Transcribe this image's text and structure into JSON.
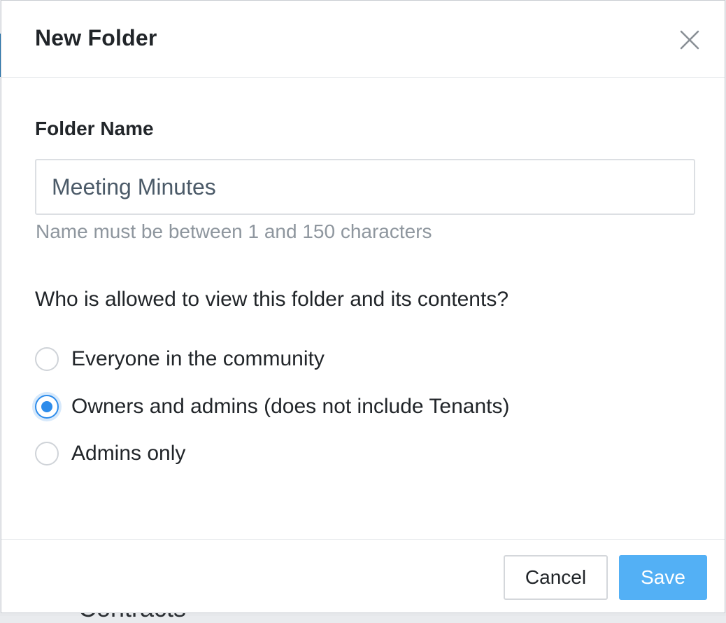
{
  "background": {
    "partial_text": "Contracts"
  },
  "dialog": {
    "title": "New Folder",
    "close_icon": "close-icon"
  },
  "folder_name": {
    "label": "Folder Name",
    "value": "Meeting Minutes",
    "hint": "Name must be between 1 and 150 characters"
  },
  "visibility": {
    "question": "Who is allowed to view this folder and its contents?",
    "options": [
      {
        "label": "Everyone in the community",
        "selected": false
      },
      {
        "label": "Owners and admins (does not include Tenants)",
        "selected": true
      },
      {
        "label": "Admins only",
        "selected": false
      }
    ]
  },
  "footer": {
    "cancel_label": "Cancel",
    "save_label": "Save"
  },
  "colors": {
    "accent": "#2d8ceb",
    "save_button": "#53b0f5"
  }
}
